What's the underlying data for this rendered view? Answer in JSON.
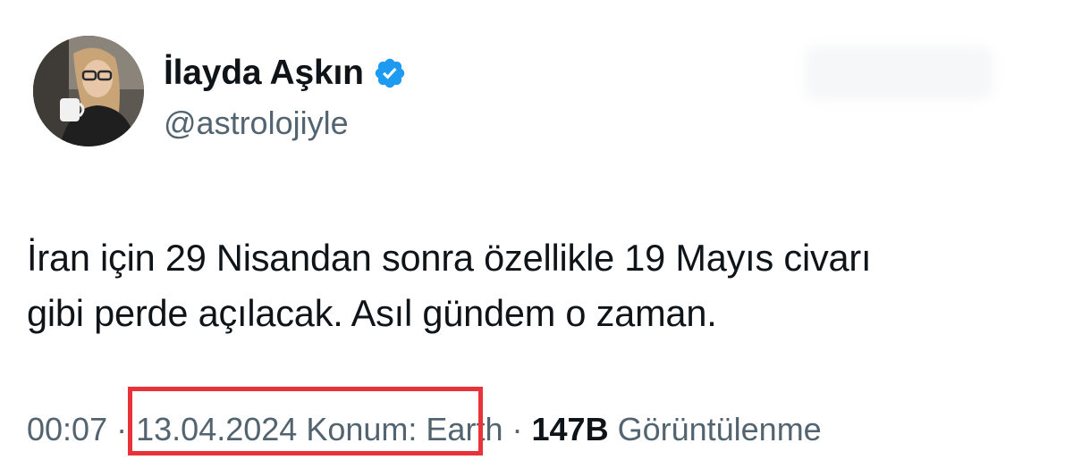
{
  "author": {
    "display_name": "İlayda Aşkın",
    "handle": "@astrolojiyle",
    "verified": true
  },
  "tweet": {
    "text_line1": "İran için 29 Nisandan sonra özellikle 19 Mayıs civarı",
    "text_line2": "gibi perde açılacak. Asıl gündem o zaman."
  },
  "meta": {
    "time": "00:07",
    "separator": "·",
    "date": "13.04.2024",
    "location_label": "Konum:",
    "location_value": "Earth",
    "views_count": "147B",
    "views_label": "Görüntülenme"
  },
  "colors": {
    "text_primary": "#0f1419",
    "text_secondary": "#536471",
    "verified_badge": "#1d9bf0",
    "highlight_border": "#e8333b"
  },
  "icons": {
    "verified": "verified-badge-icon"
  }
}
